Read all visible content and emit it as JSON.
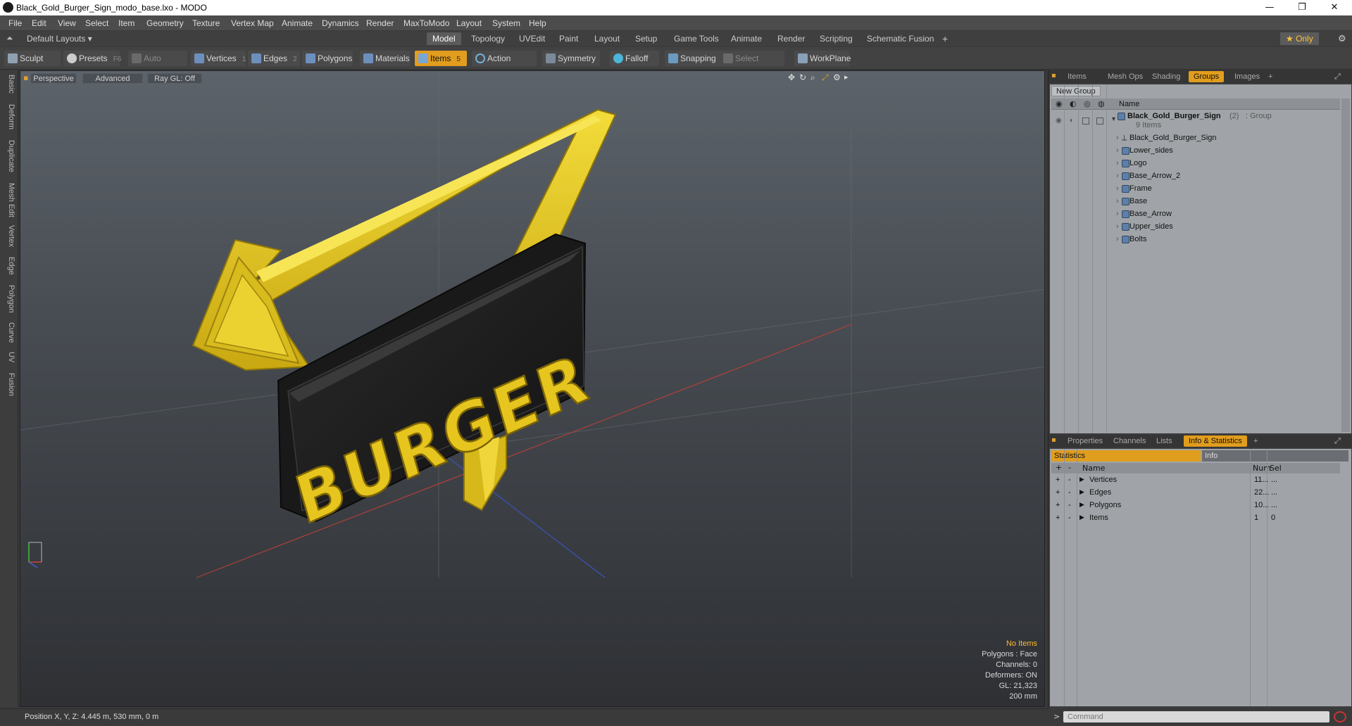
{
  "window": {
    "title": "Black_Gold_Burger_Sign_modo_base.lxo - MODO",
    "minimize": "—",
    "maximize": "❐",
    "close": "✕"
  },
  "menu": [
    "File",
    "Edit",
    "View",
    "Select",
    "Item",
    "Geometry",
    "Texture",
    "Vertex Map",
    "Animate",
    "Dynamics",
    "Render",
    "MaxToModo",
    "Layout",
    "System",
    "Help"
  ],
  "layout": {
    "preset": "Default Layouts ▾",
    "tabs": [
      "Model",
      "Topology",
      "UVEdit",
      "Paint",
      "Layout",
      "Setup",
      "Game Tools",
      "Animate",
      "Render",
      "Scripting",
      "Schematic Fusion"
    ],
    "active": "Model",
    "add": "+",
    "only": "★  Only",
    "gear": "⚙"
  },
  "toolbar": {
    "sculpt": "Sculpt",
    "presets": "Presets",
    "presets_key": "F6",
    "auto_select": "Auto Select",
    "vertices": "Vertices",
    "vertices_count": "1",
    "edges": "Edges",
    "edges_count": "2",
    "polygons": "Polygons",
    "materials": "Materials",
    "items": "Items",
    "items_count": "5",
    "action_center": "Action Center",
    "symmetry": "Symmetry",
    "falloff": "Falloff",
    "snapping": "Snapping",
    "select_through": "Select Through",
    "workplane": "WorkPlane"
  },
  "left_tabs": [
    "Basic",
    "Deform",
    "Duplicate",
    "Mesh Edit",
    "Vertex",
    "Edge",
    "Polygon",
    "Curve",
    "UV",
    "Fusion"
  ],
  "viewport": {
    "view": "Perspective",
    "shading": "Advanced",
    "raygl": "Ray GL: Off",
    "sign_text": "BURGER",
    "stats": {
      "no_items": "No Items",
      "polygons": "Polygons : Face",
      "channels": "Channels: 0",
      "deformers": "Deformers: ON",
      "gl": "GL: 21,323",
      "scale": "200 mm"
    }
  },
  "status": {
    "position": "Position X, Y, Z:  4.445 m, 530 mm, 0 m"
  },
  "top_panel": {
    "tabs": [
      "Items",
      "Mesh Ops",
      "Shading",
      "Groups",
      "Images"
    ],
    "active": "Groups",
    "add": "+",
    "new_group": "New Group",
    "col_name": "Name",
    "group": {
      "name": "Black_Gold_Burger_Sign",
      "count": "(2)",
      "type": ": Group",
      "sub": "9 Items"
    },
    "items": [
      "Black_Gold_Burger_Sign",
      "Lower_sides",
      "Logo",
      "Base_Arrow_2",
      "Frame",
      "Base",
      "Base_Arrow",
      "Upper_sides",
      "Bolts"
    ]
  },
  "bottom_panel": {
    "tabs": [
      "Properties",
      "Channels",
      "Lists",
      "Info & Statistics"
    ],
    "active": "Info & Statistics",
    "add": "+",
    "statistics_tab": "Statistics",
    "info_tab": "Info",
    "col_name": "Name",
    "col_num": "Num",
    "col_sel": "Sel",
    "rows": [
      {
        "name": "Vertices",
        "num": "11...",
        "sel": "..."
      },
      {
        "name": "Edges",
        "num": "22...",
        "sel": "..."
      },
      {
        "name": "Polygons",
        "num": "10...",
        "sel": "..."
      },
      {
        "name": "Items",
        "num": "1",
        "sel": "0"
      }
    ]
  },
  "command": {
    "prompt": ">",
    "placeholder": "Command"
  },
  "colors": {
    "accent": "#e19d1d",
    "gold": "#e5c220",
    "sign_black": "#1e1e1e"
  }
}
